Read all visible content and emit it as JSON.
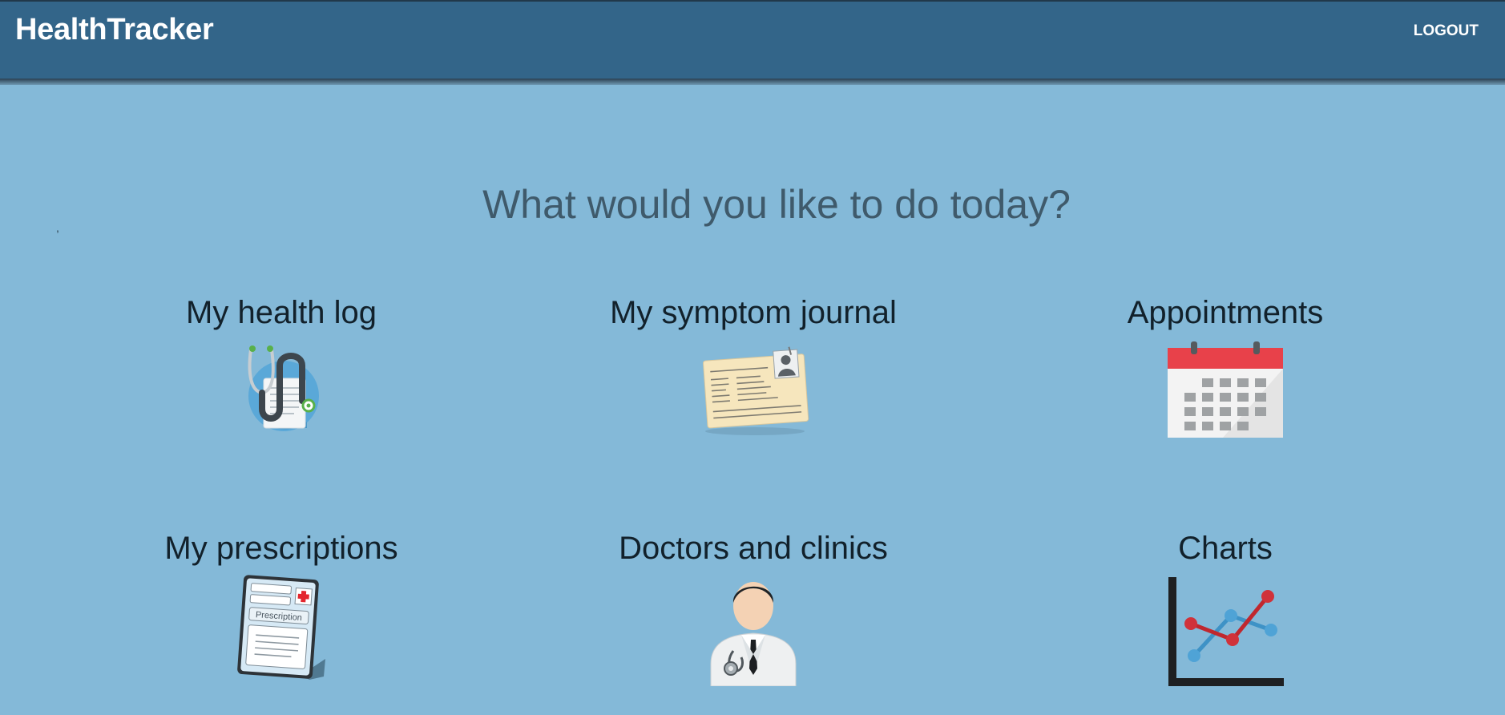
{
  "app": {
    "brand": "HealthTracker",
    "logout_label": "LOGOUT"
  },
  "main": {
    "stray_mark": ",",
    "headline": "What would you like to do today?",
    "tiles": [
      {
        "label": "My health log",
        "icon": "stethoscope-document-icon"
      },
      {
        "label": "My symptom journal",
        "icon": "medical-card-icon"
      },
      {
        "label": "Appointments",
        "icon": "calendar-icon"
      },
      {
        "label": "My prescriptions",
        "icon": "prescription-pad-icon"
      },
      {
        "label": "Doctors and clinics",
        "icon": "doctor-icon"
      },
      {
        "label": "Charts",
        "icon": "line-chart-icon"
      }
    ]
  },
  "colors": {
    "appbar": "#336589",
    "background": "#84b9d8",
    "headline": "#3f5a6b"
  }
}
